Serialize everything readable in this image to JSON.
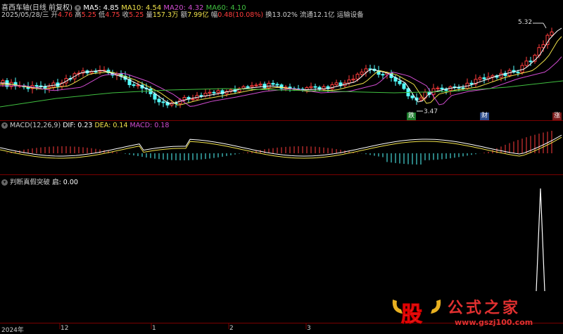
{
  "header": {
    "title": "喜西车轴(日线 前复权)",
    "ma": [
      {
        "label": "MA5: 4.85",
        "color": "#ffffff"
      },
      {
        "label": "MA10: 4.54",
        "color": "#f0e24a"
      },
      {
        "label": "MA20: 4.32",
        "color": "#d14cd1"
      },
      {
        "label": "MA60: 4.10",
        "color": "#40c040"
      }
    ]
  },
  "quote": {
    "date": "2025/05/28/三",
    "open_label": "开",
    "open": "4.76",
    "high_label": "高",
    "high": "5.25",
    "low_label": "低",
    "low": "4.75",
    "close_label": "收",
    "close": "5.25",
    "vol_label": "量",
    "vol": "157.3万",
    "amt_label": "额",
    "amt": "7.99亿",
    "chg_label": "幅",
    "chg": "0.48(10.08%)",
    "turn_label": "换",
    "turn": "13.02%",
    "float_label": "流通",
    "float": "12.1亿",
    "sector": "运输设备"
  },
  "annotations": {
    "high_price": "5.32",
    "low_price": "3.47",
    "tag_drop": "跌",
    "tag_fin": "财",
    "tag_up": "涨"
  },
  "macd": {
    "title": "MACD(12,26,9)",
    "dif": "DIF: 0.23",
    "dea": "DEA: 0.14",
    "macd": "MACD: 0.18"
  },
  "indicator": {
    "title": "判断真假突破",
    "value": "启: 0.00"
  },
  "xaxis": {
    "labels": [
      "2024年",
      "12",
      "1",
      "2",
      "3"
    ]
  },
  "watermark": {
    "logo": "股",
    "name": "公式之家",
    "url": "www.gszj100.com"
  },
  "colors": {
    "up": "#ff3c3c",
    "down": "#54ffff",
    "bg": "#000000"
  }
}
